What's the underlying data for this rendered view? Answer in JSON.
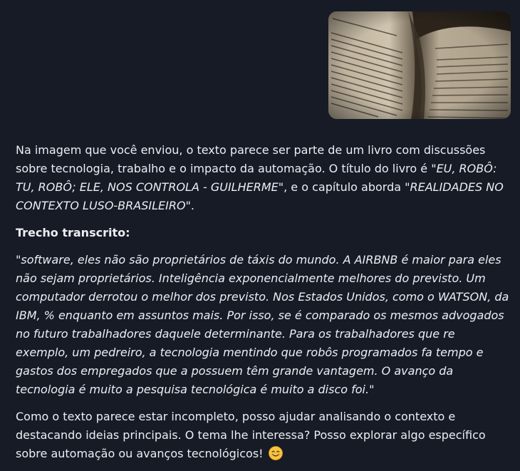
{
  "attachment": {
    "icon": "open-book-photo"
  },
  "reply": {
    "intro": {
      "lead": "Na imagem que você enviou, o texto parece ser parte de um livro com discussões sobre tecnologia, trabalho e o impacto da automação. O título do livro é ",
      "book_title": "\"EU, ROBÔ: TU, ROBÔ; ELE, NOS CONTROLA - GUILHERME\"",
      "middle": ", e o capítulo aborda ",
      "chapter": "\"REALIDADES NO CONTEXTO LUSO-BRASILEIRO\"",
      "end": "."
    },
    "heading": "Trecho transcrito:",
    "quote": "\"software, eles não são proprietários de táxis do mundo. A AIRBNB é maior para eles não sejam proprietários. Inteligência exponencialmente melhores do previsto. Um computador derrotou o melhor dos previsto. Nos Estados Unidos, como o WATSON, da IBM, % enquanto em assuntos mais. Por isso, se é comparado os mesmos advogados no futuro trabalhadores daquele determinante. Para os trabalhadores que re exemplo, um pedreiro, a tecnologia mentindo que robôs programados fa tempo e gastos dos empregados que a possuem têm grande vantagem. O avanço da tecnologia é muito a pesquisa tecnológica é muito a disco foi.\"",
    "closing": "Como o texto parece estar incompleto, posso ajudar analisando o contexto e destacando ideias principais. O tema lhe interessa? Posso explorar algo específico sobre automação ou avanços tecnológicos!",
    "emoji": "smiling-face-emoji"
  }
}
